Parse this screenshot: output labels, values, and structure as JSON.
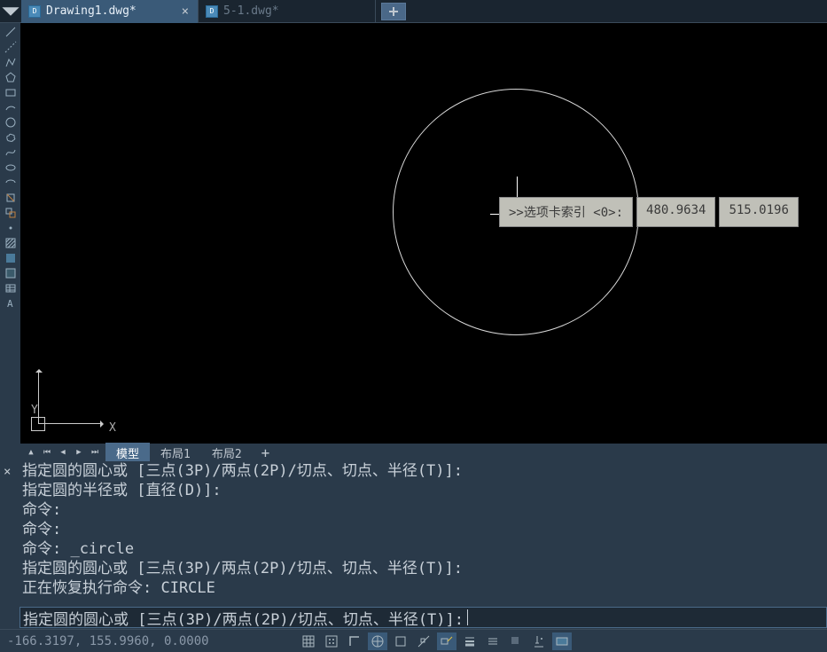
{
  "tabs": {
    "items": [
      {
        "label": "Drawing1.dwg*",
        "active": true
      },
      {
        "label": "5-1.dwg*",
        "active": false
      }
    ]
  },
  "canvas": {
    "tooltip_prompt": ">>选项卡索引 <0>:",
    "tooltip_value1": "480.9634",
    "tooltip_value2": "515.0196",
    "ucs_x": "X",
    "ucs_y": "Y"
  },
  "layout_tabs": {
    "items": [
      {
        "label": "模型",
        "active": true
      },
      {
        "label": "布局1",
        "active": false
      },
      {
        "label": "布局2",
        "active": false
      }
    ],
    "add": "+"
  },
  "command_history": [
    "指定圆的圆心或 [三点(3P)/两点(2P)/切点、切点、半径(T)]:",
    "指定圆的半径或 [直径(D)]:",
    "命令:",
    "命令:",
    "命令: _circle",
    "指定圆的圆心或 [三点(3P)/两点(2P)/切点、切点、半径(T)]:",
    "正在恢复执行命令: CIRCLE"
  ],
  "command_input": "指定圆的圆心或 [三点(3P)/两点(2P)/切点、切点、半径(T)]: ",
  "status": {
    "coords": "-166.3197, 155.9960, 0.0000"
  },
  "tool_icons": [
    "line",
    "construction-line",
    "polyline",
    "polygon",
    "rectangle",
    "arc",
    "circle",
    "revcloud",
    "spline",
    "ellipse",
    "ellipse-arc",
    "insert-block",
    "make-block",
    "point",
    "hatch",
    "gradient",
    "region",
    "table",
    "mtext"
  ],
  "status_toggles": [
    {
      "name": "grid",
      "on": false
    },
    {
      "name": "snap",
      "on": false
    },
    {
      "name": "ortho",
      "on": false
    },
    {
      "name": "polar",
      "on": true
    },
    {
      "name": "osnap",
      "on": false
    },
    {
      "name": "otrack",
      "on": false
    },
    {
      "name": "dyn",
      "on": true
    },
    {
      "name": "lwt",
      "on": false
    },
    {
      "name": "linewt",
      "on": false
    },
    {
      "name": "selection",
      "on": false
    },
    {
      "name": "annot",
      "on": false
    },
    {
      "name": "model-btn",
      "on": true
    }
  ]
}
